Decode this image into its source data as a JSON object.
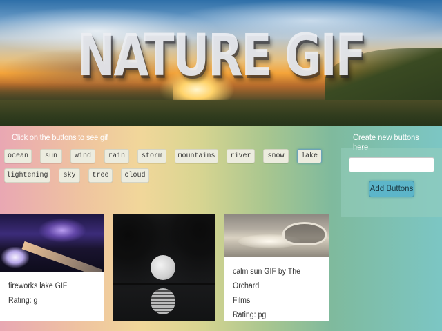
{
  "hero": {
    "title": "NATURE GIF"
  },
  "controls": {
    "instructions": "Click on the buttons to see gif",
    "topics": [
      {
        "label": "ocean"
      },
      {
        "label": "sun"
      },
      {
        "label": "wind"
      },
      {
        "label": "rain"
      },
      {
        "label": "storm"
      },
      {
        "label": "mountains"
      },
      {
        "label": "river"
      },
      {
        "label": "snow"
      },
      {
        "label": "lake",
        "active": true
      },
      {
        "label": "lightening"
      },
      {
        "label": "sky"
      },
      {
        "label": "tree"
      },
      {
        "label": "cloud"
      }
    ]
  },
  "create": {
    "label": "Create new buttons here",
    "input_value": "",
    "add_button": "Add Buttons"
  },
  "gifs": [
    {
      "title": "fireworks lake GIF",
      "rating": "Rating: g"
    },
    {
      "title": "",
      "rating": ""
    },
    {
      "title_line1": "calm sun GIF by The Orchard",
      "title_line2": "Films",
      "rating": "Rating: pg"
    }
  ]
}
